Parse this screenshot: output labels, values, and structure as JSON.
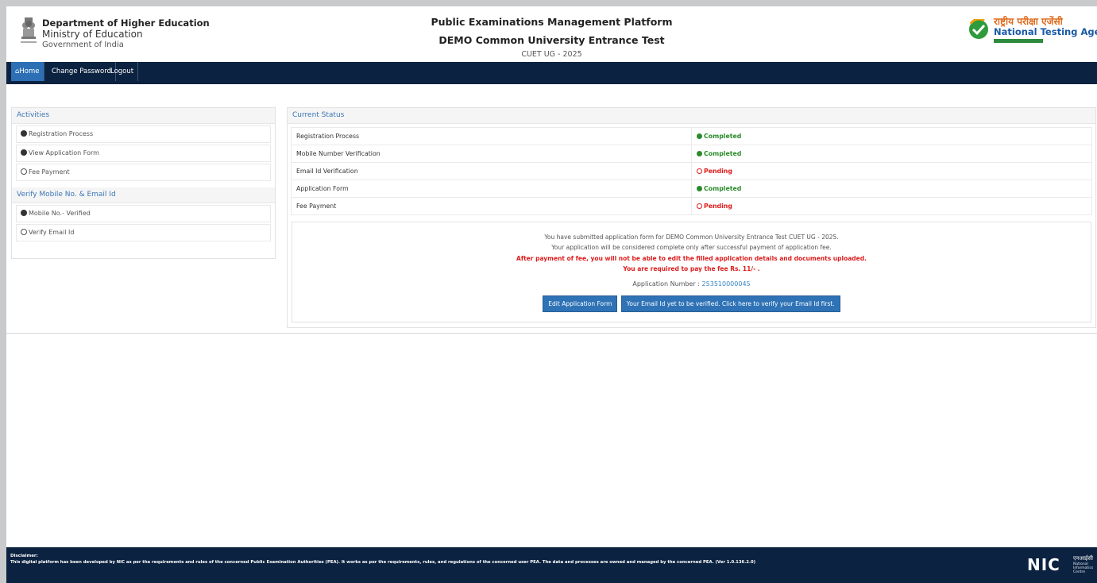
{
  "header": {
    "dept_line1": "Department of Higher Education",
    "dept_line2": "Ministry of Education",
    "dept_line3": "Government of India",
    "title1": "Public Examinations Management Platform",
    "title2": "DEMO Common University Entrance Test",
    "title3": "CUET UG - 2025",
    "nta_hindi": "राष्ट्रीय परीक्षा एजेंसी",
    "nta_english": "National Testing Agency"
  },
  "nav": {
    "home": "Home",
    "change_password": "Change Password",
    "logout": "Logout"
  },
  "activities": {
    "title": "Activities",
    "items": [
      {
        "label": "Registration Process"
      },
      {
        "label": "View Application Form"
      },
      {
        "label": "Fee Payment"
      }
    ]
  },
  "verify": {
    "title": "Verify Mobile No. & Email Id",
    "items": [
      {
        "label": "Mobile No.- Verified"
      },
      {
        "label": "Verify Email Id"
      }
    ]
  },
  "status": {
    "title": "Current Status",
    "rows": [
      {
        "label": "Registration Process",
        "value": "Completed"
      },
      {
        "label": "Mobile Number Verification",
        "value": "Completed"
      },
      {
        "label": "Email Id Verification",
        "value": "Pending"
      },
      {
        "label": "Application Form",
        "value": "Completed"
      },
      {
        "label": "Fee Payment",
        "value": "Pending"
      }
    ]
  },
  "message": {
    "line1": "You have submitted application form for DEMO Common University Entrance Test CUET UG - 2025.",
    "line2": "Your application will be considered complete only after successful payment of application fee.",
    "line3": "After payment of fee, you will not be able to edit the filled application details and documents uploaded.",
    "line4": "You are required to pay the fee Rs. 11/- .",
    "app_label": "Application Number :",
    "app_number": "253510000045",
    "edit_button": "Edit Application Form",
    "verify_button": "Your Email Id yet to be verified. Click here to verify your Email Id first."
  },
  "footer": {
    "disclaimer_title": "Disclaimer:",
    "disclaimer_text": "This digital platform has been developed by NIC as per the requirements and rules of the concerned Public Examination Authorities (PEA). It works as per the requirements, rules, and regulations of the concerned user PEA. The data and processes are owned and managed by the concerned PEA. (Ver 1.0.136.2.0)",
    "nic": "NIC",
    "nic_hindi": "एनआईसी",
    "nic_sub": "National Informatics Centre"
  },
  "colors": {
    "navbar": "#0b2240",
    "accent": "#2f73b6",
    "completed": "#2a8b2a",
    "pending": "#dd1b1b"
  }
}
